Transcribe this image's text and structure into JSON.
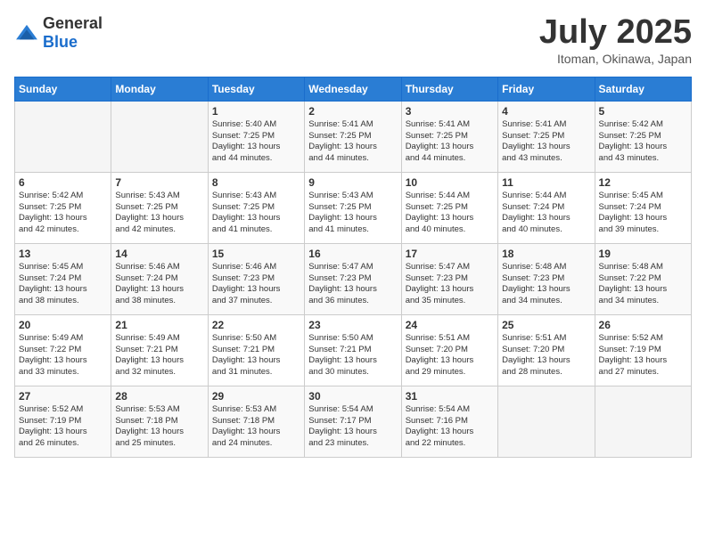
{
  "header": {
    "logo_general": "General",
    "logo_blue": "Blue",
    "month_title": "July 2025",
    "location": "Itoman, Okinawa, Japan"
  },
  "weekdays": [
    "Sunday",
    "Monday",
    "Tuesday",
    "Wednesday",
    "Thursday",
    "Friday",
    "Saturday"
  ],
  "weeks": [
    [
      {
        "day": "",
        "info": ""
      },
      {
        "day": "",
        "info": ""
      },
      {
        "day": "1",
        "sunrise": "5:40 AM",
        "sunset": "7:25 PM",
        "daylight": "13 hours and 44 minutes."
      },
      {
        "day": "2",
        "sunrise": "5:41 AM",
        "sunset": "7:25 PM",
        "daylight": "13 hours and 44 minutes."
      },
      {
        "day": "3",
        "sunrise": "5:41 AM",
        "sunset": "7:25 PM",
        "daylight": "13 hours and 44 minutes."
      },
      {
        "day": "4",
        "sunrise": "5:41 AM",
        "sunset": "7:25 PM",
        "daylight": "13 hours and 43 minutes."
      },
      {
        "day": "5",
        "sunrise": "5:42 AM",
        "sunset": "7:25 PM",
        "daylight": "13 hours and 43 minutes."
      }
    ],
    [
      {
        "day": "6",
        "sunrise": "5:42 AM",
        "sunset": "7:25 PM",
        "daylight": "13 hours and 42 minutes."
      },
      {
        "day": "7",
        "sunrise": "5:43 AM",
        "sunset": "7:25 PM",
        "daylight": "13 hours and 42 minutes."
      },
      {
        "day": "8",
        "sunrise": "5:43 AM",
        "sunset": "7:25 PM",
        "daylight": "13 hours and 41 minutes."
      },
      {
        "day": "9",
        "sunrise": "5:43 AM",
        "sunset": "7:25 PM",
        "daylight": "13 hours and 41 minutes."
      },
      {
        "day": "10",
        "sunrise": "5:44 AM",
        "sunset": "7:25 PM",
        "daylight": "13 hours and 40 minutes."
      },
      {
        "day": "11",
        "sunrise": "5:44 AM",
        "sunset": "7:24 PM",
        "daylight": "13 hours and 40 minutes."
      },
      {
        "day": "12",
        "sunrise": "5:45 AM",
        "sunset": "7:24 PM",
        "daylight": "13 hours and 39 minutes."
      }
    ],
    [
      {
        "day": "13",
        "sunrise": "5:45 AM",
        "sunset": "7:24 PM",
        "daylight": "13 hours and 38 minutes."
      },
      {
        "day": "14",
        "sunrise": "5:46 AM",
        "sunset": "7:24 PM",
        "daylight": "13 hours and 38 minutes."
      },
      {
        "day": "15",
        "sunrise": "5:46 AM",
        "sunset": "7:23 PM",
        "daylight": "13 hours and 37 minutes."
      },
      {
        "day": "16",
        "sunrise": "5:47 AM",
        "sunset": "7:23 PM",
        "daylight": "13 hours and 36 minutes."
      },
      {
        "day": "17",
        "sunrise": "5:47 AM",
        "sunset": "7:23 PM",
        "daylight": "13 hours and 35 minutes."
      },
      {
        "day": "18",
        "sunrise": "5:48 AM",
        "sunset": "7:23 PM",
        "daylight": "13 hours and 34 minutes."
      },
      {
        "day": "19",
        "sunrise": "5:48 AM",
        "sunset": "7:22 PM",
        "daylight": "13 hours and 34 minutes."
      }
    ],
    [
      {
        "day": "20",
        "sunrise": "5:49 AM",
        "sunset": "7:22 PM",
        "daylight": "13 hours and 33 minutes."
      },
      {
        "day": "21",
        "sunrise": "5:49 AM",
        "sunset": "7:21 PM",
        "daylight": "13 hours and 32 minutes."
      },
      {
        "day": "22",
        "sunrise": "5:50 AM",
        "sunset": "7:21 PM",
        "daylight": "13 hours and 31 minutes."
      },
      {
        "day": "23",
        "sunrise": "5:50 AM",
        "sunset": "7:21 PM",
        "daylight": "13 hours and 30 minutes."
      },
      {
        "day": "24",
        "sunrise": "5:51 AM",
        "sunset": "7:20 PM",
        "daylight": "13 hours and 29 minutes."
      },
      {
        "day": "25",
        "sunrise": "5:51 AM",
        "sunset": "7:20 PM",
        "daylight": "13 hours and 28 minutes."
      },
      {
        "day": "26",
        "sunrise": "5:52 AM",
        "sunset": "7:19 PM",
        "daylight": "13 hours and 27 minutes."
      }
    ],
    [
      {
        "day": "27",
        "sunrise": "5:52 AM",
        "sunset": "7:19 PM",
        "daylight": "13 hours and 26 minutes."
      },
      {
        "day": "28",
        "sunrise": "5:53 AM",
        "sunset": "7:18 PM",
        "daylight": "13 hours and 25 minutes."
      },
      {
        "day": "29",
        "sunrise": "5:53 AM",
        "sunset": "7:18 PM",
        "daylight": "13 hours and 24 minutes."
      },
      {
        "day": "30",
        "sunrise": "5:54 AM",
        "sunset": "7:17 PM",
        "daylight": "13 hours and 23 minutes."
      },
      {
        "day": "31",
        "sunrise": "5:54 AM",
        "sunset": "7:16 PM",
        "daylight": "13 hours and 22 minutes."
      },
      {
        "day": "",
        "info": ""
      },
      {
        "day": "",
        "info": ""
      }
    ]
  ]
}
